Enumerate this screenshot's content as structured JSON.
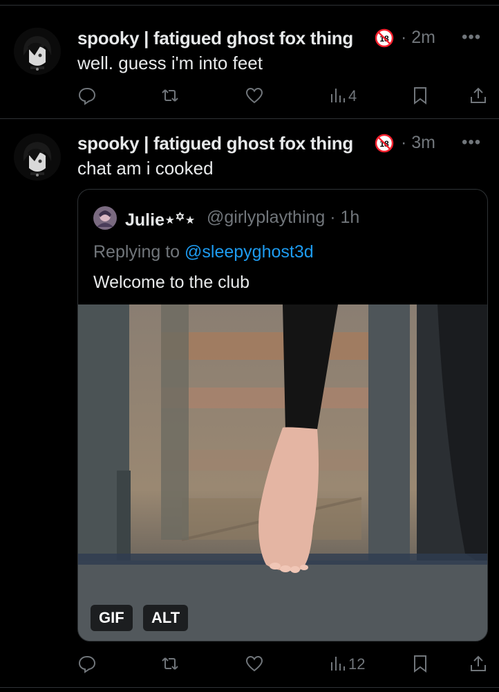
{
  "posts": [
    {
      "display_name": "spooky | fatigued ghost fox thing",
      "time": "· 2m",
      "more": "•••",
      "body": "well. guess i'm into feet",
      "views": "4"
    },
    {
      "display_name": "spooky | fatigued ghost fox thing",
      "time": "· 3m",
      "more": "•••",
      "body": "chat am i cooked",
      "views": "12",
      "quote": {
        "name": "Julie⋆꙳⋆",
        "handle": "@girlyplaything · 1h",
        "replying_prefix": "Replying to ",
        "replying_handle": "@sleepyghost3d",
        "body": "Welcome to the club",
        "gif_label": "GIF",
        "alt_label": "ALT"
      }
    }
  ],
  "icons": {
    "age_badge": "18-plus-badge-icon",
    "reply": "reply-icon",
    "repost": "repost-icon",
    "like": "like-icon",
    "views": "views-icon",
    "bookmark": "bookmark-icon",
    "share": "share-icon"
  },
  "colors": {
    "background": "#000000",
    "text": "#e7e9ea",
    "muted": "#71767b",
    "link": "#1d9bf0",
    "divider": "#2f3336",
    "badge_red": "#f4212e"
  }
}
